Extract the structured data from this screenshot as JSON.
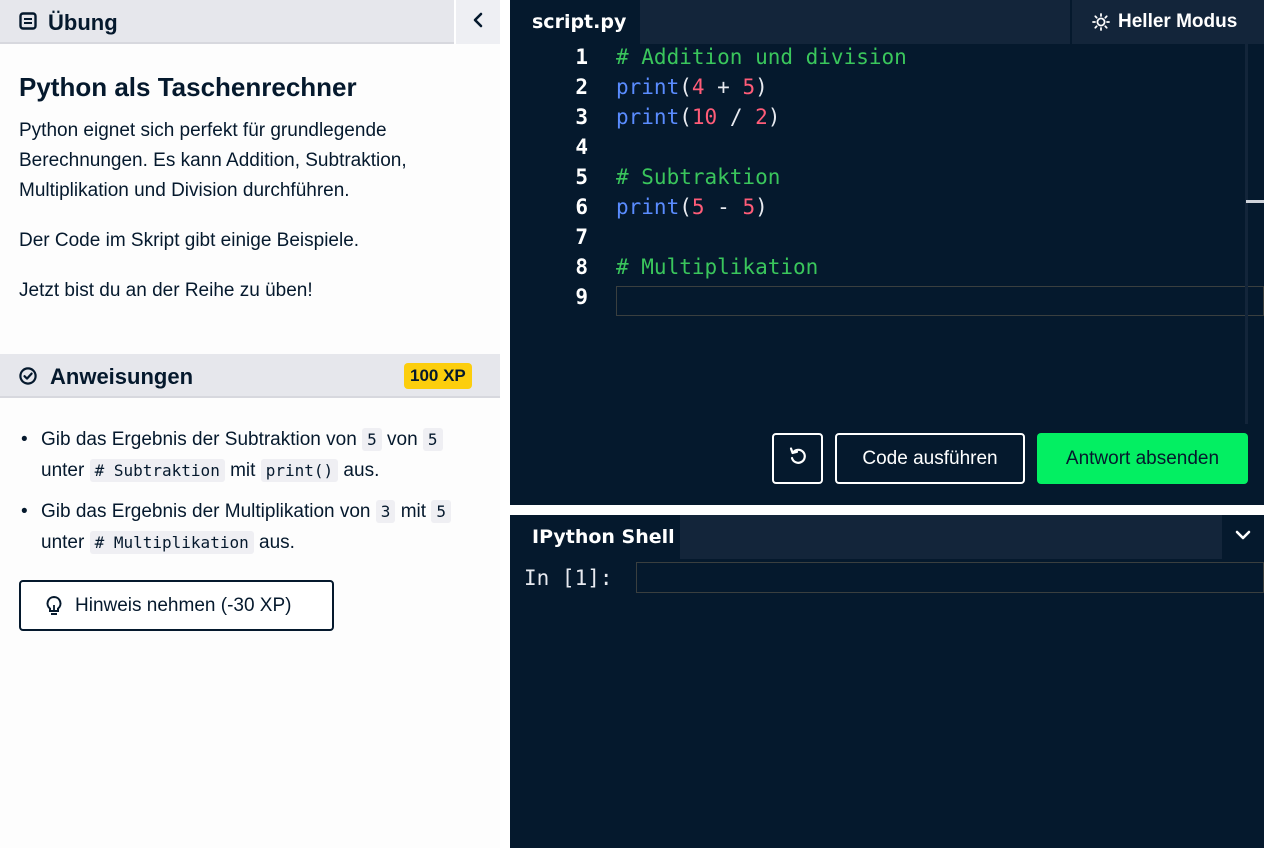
{
  "exercise": {
    "header_label": "Übung",
    "title": "Python als Taschenrechner",
    "paragraphs": [
      "Python eignet sich perfekt für grundlegende Berechnungen. Es kann Addition, Subtraktion, Multiplikation und Division durchführen.",
      "Der Code im Skript gibt einige Beispiele.",
      "Jetzt bist du an der Reihe zu üben!"
    ]
  },
  "instructions": {
    "header_label": "Anweisungen",
    "xp": "100 XP",
    "items": [
      {
        "t1": "Gib das Ergebnis der Subtraktion von ",
        "c1": "5",
        "t2": " von ",
        "c2": "5",
        "t3": " unter ",
        "c3": "# Subtraktion",
        "t4": " mit ",
        "c4": "print()",
        "t5": " aus."
      },
      {
        "t1": "Gib das Ergebnis der Multiplikation von ",
        "c1": "3",
        "t2": " mit ",
        "c2": "5",
        "t3": " unter ",
        "c3": "# Multiplikation",
        "t4": " aus."
      }
    ],
    "hint_button": "Hinweis nehmen (-30 XP)"
  },
  "editor": {
    "tab_label": "script.py",
    "light_mode_label": "Heller Modus",
    "line_numbers": [
      "1",
      "2",
      "3",
      "4",
      "5",
      "6",
      "7",
      "8",
      "9"
    ],
    "lines": {
      "l1_comment": "# Addition und division",
      "l2_func": "print",
      "l2_open": "(",
      "l2_a": "4",
      "l2_op": " + ",
      "l2_b": "5",
      "l2_close": ")",
      "l3_func": "print",
      "l3_open": "(",
      "l3_a": "10",
      "l3_op": " / ",
      "l3_b": "2",
      "l3_close": ")",
      "l5_comment": "# Subtraktion",
      "l6_func": "print",
      "l6_open": "(",
      "l6_a": "5",
      "l6_op": " - ",
      "l6_b": "5",
      "l6_close": ")",
      "l8_comment": "# Multiplikation"
    },
    "run_button": "Code ausführen",
    "submit_button": "Antwort absenden"
  },
  "shell": {
    "tab_label": "IPython Shell",
    "prompt": "In [1]:"
  },
  "colors": {
    "accent_green": "#03ef62",
    "xp_yellow": "#fcce0d",
    "editor_bg": "#05192d",
    "comment": "#3ac65c",
    "function": "#5a8cff",
    "number": "#ff5c78"
  },
  "icons": [
    "exercise-icon",
    "chevron-left-icon",
    "check-circle-icon",
    "bulb-icon",
    "sun-icon",
    "reset-icon",
    "chevron-down-icon"
  ]
}
